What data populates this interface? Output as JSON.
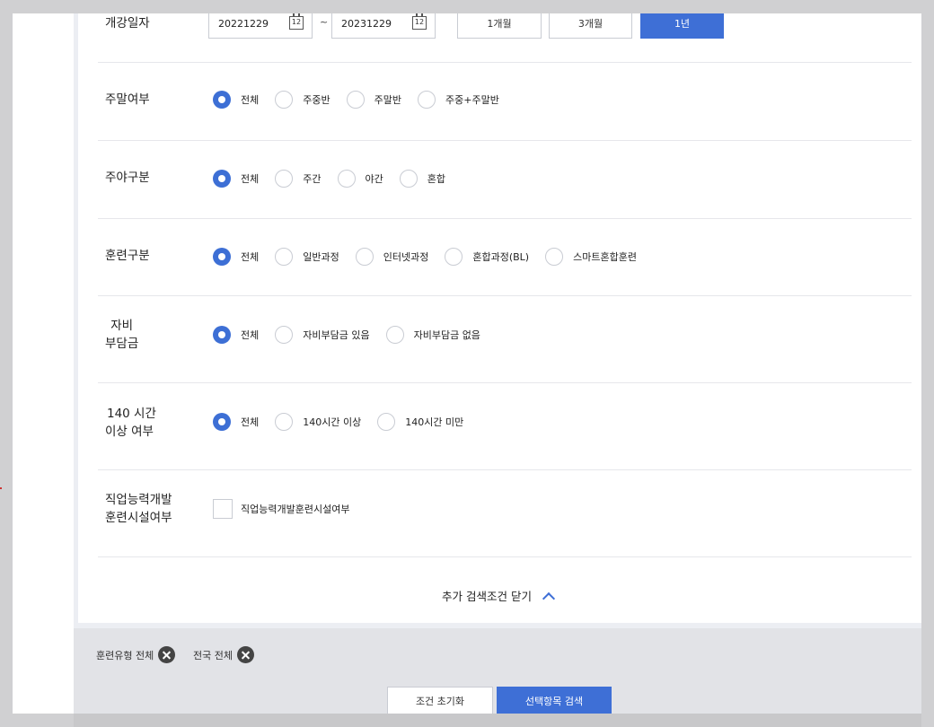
{
  "date_row": {
    "label": "개강일자",
    "start_date": "20221229",
    "end_date": "20231229",
    "tilde": "~",
    "calendar_day": "12",
    "periods": [
      "1개월",
      "3개월",
      "1년"
    ],
    "active_period": "1년"
  },
  "weekend_row": {
    "label": "주말여부",
    "options": [
      "전체",
      "주중반",
      "주말반",
      "주중+주말반"
    ],
    "selected": "전체"
  },
  "daynight_row": {
    "label": "주야구분",
    "options": [
      "전체",
      "주간",
      "야간",
      "혼합"
    ],
    "selected": "전체"
  },
  "training_row": {
    "label": "훈련구분",
    "options": [
      "전체",
      "일반과정",
      "인터넷과정",
      "혼합과정(BL)",
      "스마트혼합훈련"
    ],
    "selected": "전체"
  },
  "copay_row": {
    "label_line1": "자비",
    "label_line2": "부담금",
    "options": [
      "전체",
      "자비부담금 있음",
      "자비부담금 없음"
    ],
    "selected": "전체"
  },
  "hours_row": {
    "label_line1": "140 시간",
    "label_line2": "이상 여부",
    "options": [
      "전체",
      "140시간 이상",
      "140시간 미만"
    ],
    "selected": "전체"
  },
  "facility_row": {
    "label_line1": "직업능력개발",
    "label_line2": "훈련시설여부",
    "checkbox_label": "직업능력개발훈련시설여부",
    "checked": false
  },
  "toggle": {
    "label": "추가 검색조건 닫기"
  },
  "chips": [
    {
      "label": "훈련유형 전체"
    },
    {
      "label": "전국 전체"
    }
  ],
  "buttons": {
    "reset": "조건 초기화",
    "search": "선택항목 검색"
  },
  "colors": {
    "accent": "#3e6fd6",
    "border": "#c9ccd3",
    "overlay": "#d0d0d2"
  }
}
